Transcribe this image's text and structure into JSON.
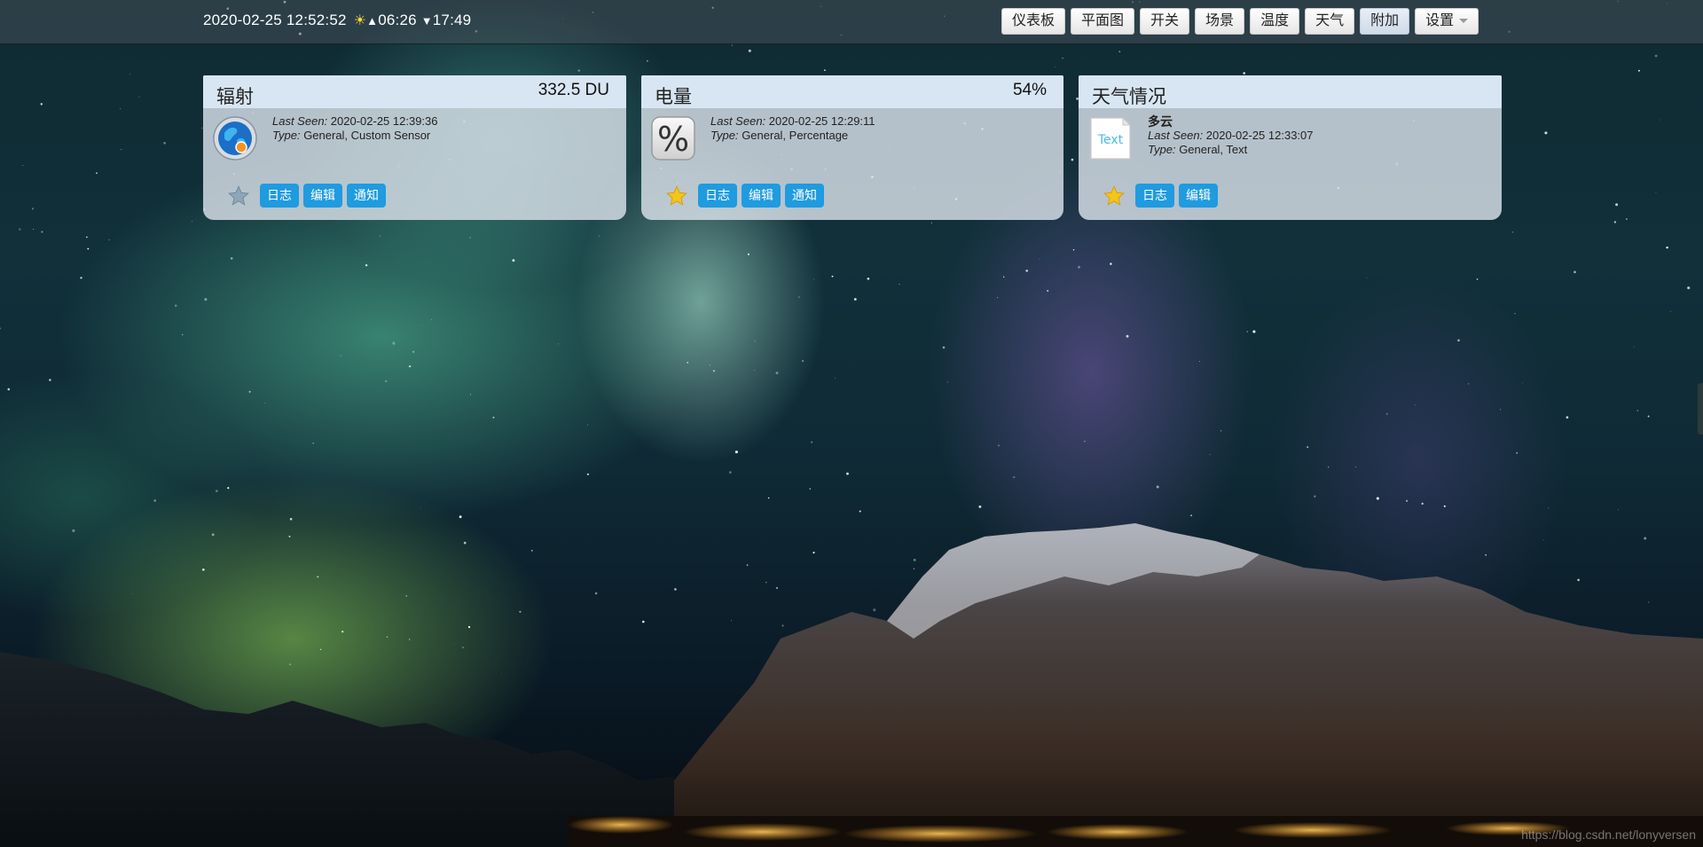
{
  "header": {
    "datetime": "2020-02-25 12:52:52",
    "sunrise": "06:26",
    "sunset": "17:49"
  },
  "nav": [
    {
      "label": "仪表板",
      "active": false
    },
    {
      "label": "平面图",
      "active": false
    },
    {
      "label": "开关",
      "active": false
    },
    {
      "label": "场景",
      "active": false
    },
    {
      "label": "温度",
      "active": false
    },
    {
      "label": "天气",
      "active": false
    },
    {
      "label": "附加",
      "active": true
    },
    {
      "label": "设置",
      "active": false,
      "dropdown": true
    }
  ],
  "cards": [
    {
      "title": "辐射",
      "value": "332.5 DU",
      "icon": "globe-sensor-icon",
      "last_seen_label": "Last Seen:",
      "last_seen": "2020-02-25 12:39:36",
      "type_label": "Type:",
      "type": "General, Custom Sensor",
      "favorite": false,
      "actions": [
        "日志",
        "编辑",
        "通知"
      ]
    },
    {
      "title": "电量",
      "value": "54%",
      "icon": "percent-icon",
      "last_seen_label": "Last Seen:",
      "last_seen": "2020-02-25 12:29:11",
      "type_label": "Type:",
      "type": "General, Percentage",
      "favorite": true,
      "actions": [
        "日志",
        "编辑",
        "通知"
      ]
    },
    {
      "title": "天气情况",
      "value": "",
      "icon": "text-document-icon",
      "icon_text": "Text",
      "name": "多云",
      "last_seen_label": "Last Seen:",
      "last_seen": "2020-02-25 12:33:07",
      "type_label": "Type:",
      "type": "General, Text",
      "favorite": true,
      "actions": [
        "日志",
        "编辑"
      ]
    }
  ],
  "watermark": "https://blog.csdn.net/lonyversen",
  "colors": {
    "action_button": "#1f9be0",
    "card_header": "#d8e6f3",
    "favorite_star": "#f5c518",
    "inactive_star": "#8fa6b8"
  }
}
